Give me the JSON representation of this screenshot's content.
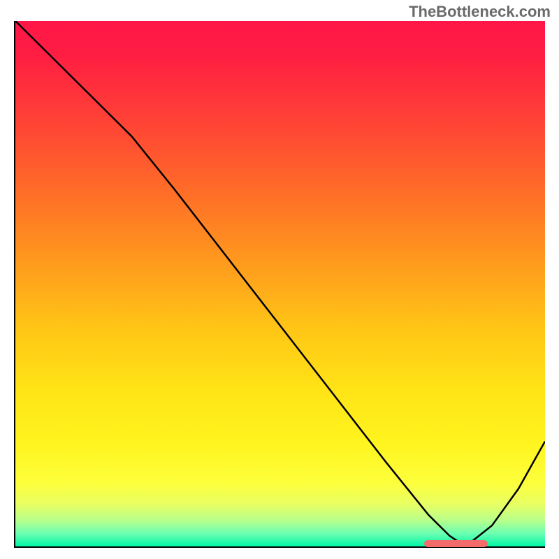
{
  "watermark": "TheBottleneck.com",
  "colors": {
    "gradient_top": "#ff1648",
    "gradient_bottom": "#00f6a6",
    "line": "#000000",
    "marker": "#f46b6b",
    "axis": "#000000"
  },
  "chart_data": {
    "type": "line",
    "title": "",
    "xlabel": "",
    "ylabel": "",
    "xlim": [
      0,
      100
    ],
    "ylim": [
      0,
      100
    ],
    "grid": false,
    "legend": false,
    "series": [
      {
        "name": "bottleneck-curve",
        "x": [
          0,
          8,
          15,
          22,
          30,
          40,
          50,
          60,
          70,
          78,
          82,
          85,
          90,
          95,
          100
        ],
        "values": [
          100,
          92,
          85,
          78,
          68,
          55,
          42,
          29,
          16,
          6,
          2,
          0,
          4,
          11,
          20
        ]
      }
    ],
    "annotations": [
      {
        "name": "optimal-range-marker",
        "x_start": 77,
        "x_end": 89,
        "y": 0.8
      }
    ],
    "background_gradient": {
      "direction": "vertical",
      "stops": [
        {
          "pos": 0.0,
          "color": "#ff1648"
        },
        {
          "pos": 0.18,
          "color": "#ff3f37"
        },
        {
          "pos": 0.46,
          "color": "#ff9a1d"
        },
        {
          "pos": 0.7,
          "color": "#ffe316"
        },
        {
          "pos": 0.88,
          "color": "#fdff3c"
        },
        {
          "pos": 0.97,
          "color": "#6dffb2"
        },
        {
          "pos": 1.0,
          "color": "#00f6a6"
        }
      ]
    }
  }
}
